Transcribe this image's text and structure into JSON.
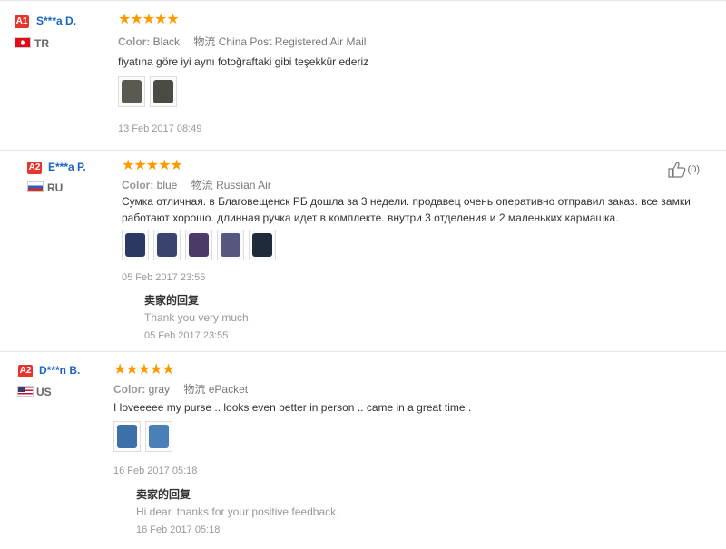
{
  "reviews": [
    {
      "level": "A1",
      "user": "S***a D.",
      "country": "TR",
      "stars": "★★★★★",
      "color_label": "Color:",
      "color_value": "Black",
      "logistics_label": "物流",
      "logistics_value": "China Post Registered Air Mail",
      "text": "fiyatına göre iyi aynı fotoğraftaki gibi teşekkür ederiz",
      "photos": [
        "#5a5a52",
        "#4a4c44"
      ],
      "date": "13 Feb 2017 08:49"
    },
    {
      "level": "A2",
      "user": "E***a P.",
      "country": "RU",
      "stars": "★★★★★",
      "color_label": "Color:",
      "color_value": "blue",
      "logistics_label": "物流",
      "logistics_value": "Russian Air",
      "text": "Сумка отличная. в Благовещенск РБ дошла за 3 недели. продавец очень оперативно отправил заказ. все замки работают хорошо. длинная ручка идет в комплекте. внутри 3 отделения и 2 маленьких кармашка.",
      "photos": [
        "#2c3763",
        "#3a4270",
        "#4a3a6a",
        "#55577e",
        "#1f2a3a"
      ],
      "date": "05 Feb 2017 23:55",
      "likes": "(0)",
      "reply": {
        "title": "卖家的回复",
        "text": "Thank you very much.",
        "date": "05 Feb 2017 23:55"
      }
    },
    {
      "level": "A2",
      "user": "D***n B.",
      "country": "US",
      "stars": "★★★★★",
      "color_label": "Color:",
      "color_value": "gray",
      "logistics_label": "物流",
      "logistics_value": "ePacket",
      "text": "I loveeeee my purse .. looks even better in person .. came in a great time .",
      "photos": [
        "#3d6fa8",
        "#4a7fb8"
      ],
      "date": "16 Feb 2017 05:18",
      "reply": {
        "title": "卖家的回复",
        "text": "Hi dear, thanks for your positive feedback.",
        "date": "16 Feb 2017 05:18"
      }
    }
  ]
}
